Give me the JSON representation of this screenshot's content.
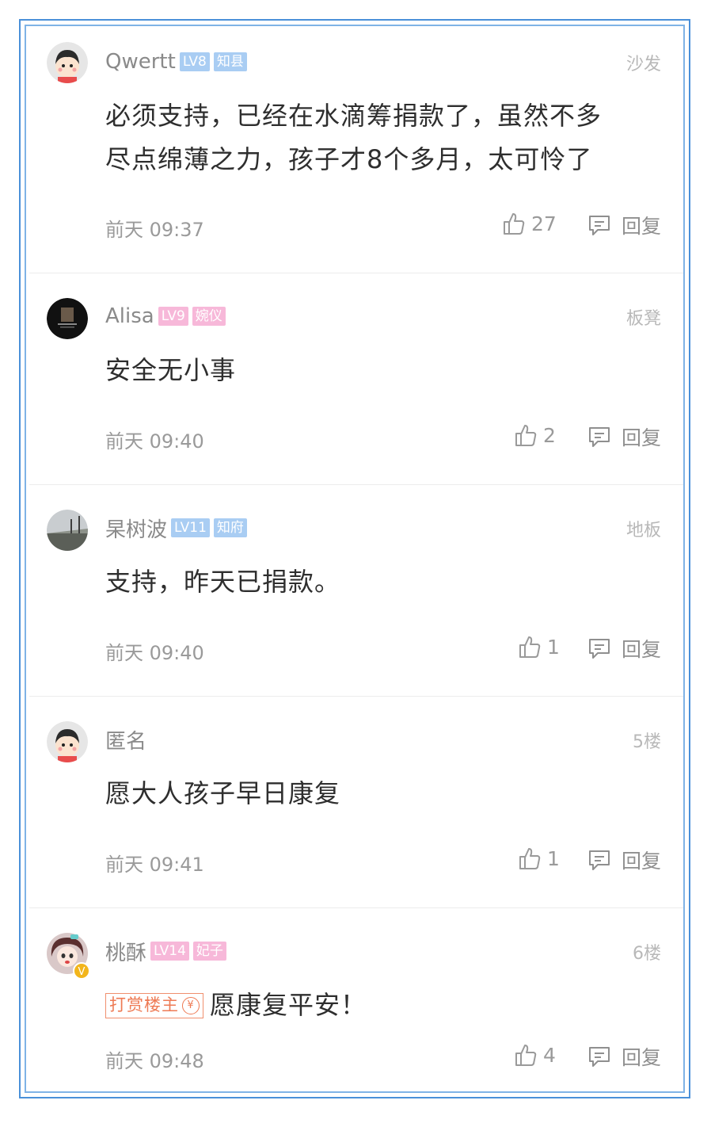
{
  "reply_label": "回复",
  "comments": [
    {
      "username": "Qwertt",
      "level": "LV8",
      "title": "知县",
      "badge_color": "blue",
      "floor": "沙发",
      "text_lines": [
        "必须支持，已经在水滴筹捐款了，虽然不多",
        "尽点绵薄之力，孩子才8个多月，太可怜了"
      ],
      "time": "前天 09:37",
      "likes": "27",
      "avatar_icon": "cartoon-kid-avatar"
    },
    {
      "username": "Alisa",
      "level": "LV9",
      "title": "婉仪",
      "badge_color": "pink",
      "floor": "板凳",
      "text_lines": [
        "安全无小事"
      ],
      "time": "前天 09:40",
      "likes": "2",
      "avatar_icon": "dark-photo-avatar"
    },
    {
      "username": "杲树波",
      "level": "LV11",
      "title": "知府",
      "badge_color": "blue",
      "floor": "地板",
      "text_lines": [
        "支持，昨天已捐款。"
      ],
      "time": "前天 09:40",
      "likes": "1",
      "avatar_icon": "landscape-photo-avatar"
    },
    {
      "username": "匿名",
      "level": "",
      "title": "",
      "badge_color": "",
      "floor": "5楼",
      "text_lines": [
        "愿大人孩子早日康复"
      ],
      "time": "前天 09:41",
      "likes": "1",
      "avatar_icon": "cartoon-kid-avatar"
    },
    {
      "username": "桃酥",
      "level": "LV14",
      "title": "妃子",
      "badge_color": "pink",
      "floor": "6楼",
      "reward_tag": "打赏楼主",
      "reward_symbol": "¥",
      "text_lines": [
        "愿康复平安！"
      ],
      "time": "前天 09:48",
      "likes": "4",
      "avatar_icon": "anime-girl-avatar"
    }
  ],
  "colors": {
    "frame": "#4a90d9",
    "badge_blue": "#a9cdf3",
    "badge_pink": "#f7b8d9",
    "reward": "#ee7a54"
  }
}
